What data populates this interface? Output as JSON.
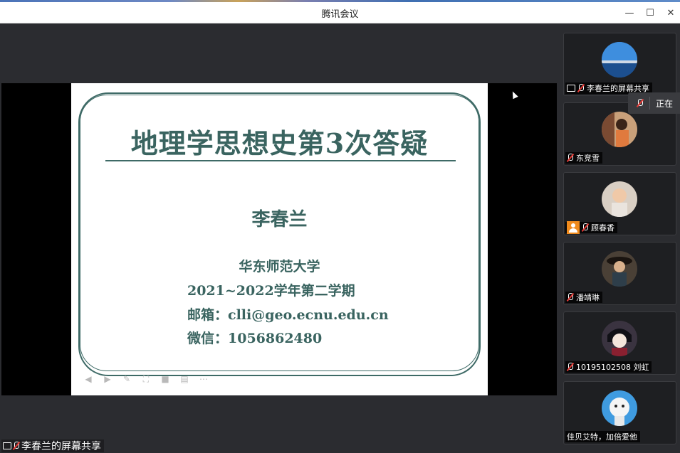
{
  "window": {
    "title": "腾讯会议",
    "minimize": "—",
    "maximize": "☐",
    "close": "✕"
  },
  "slide": {
    "title": "地理学思想史第3次答疑",
    "author": "李春兰",
    "school": "华东师范大学",
    "term": "2021~2022学年第二学期",
    "email": "邮箱：clli@geo.ecnu.edu.cn",
    "wechat": "微信：1056862480"
  },
  "share_label": "李春兰的屏幕共享",
  "popup_text": "正在",
  "participants": [
    {
      "name": "李春兰的屏幕共享",
      "avatar": "sky-bridge"
    },
    {
      "name": "东竞雪",
      "avatar": "woman-photo"
    },
    {
      "name": "顾春香",
      "avatar": "baby-photo"
    },
    {
      "name": "潘靖琳",
      "avatar": "hat-photo"
    },
    {
      "name": "10195102508 刘虹",
      "avatar": "anime-photo"
    },
    {
      "name": "佳贝艾特，加倍爱他",
      "avatar": "goat-photo"
    }
  ],
  "colors": {
    "slide_text": "#3a6460",
    "panel_bg": "#2b2c30",
    "muted_mic": "#e53935"
  }
}
